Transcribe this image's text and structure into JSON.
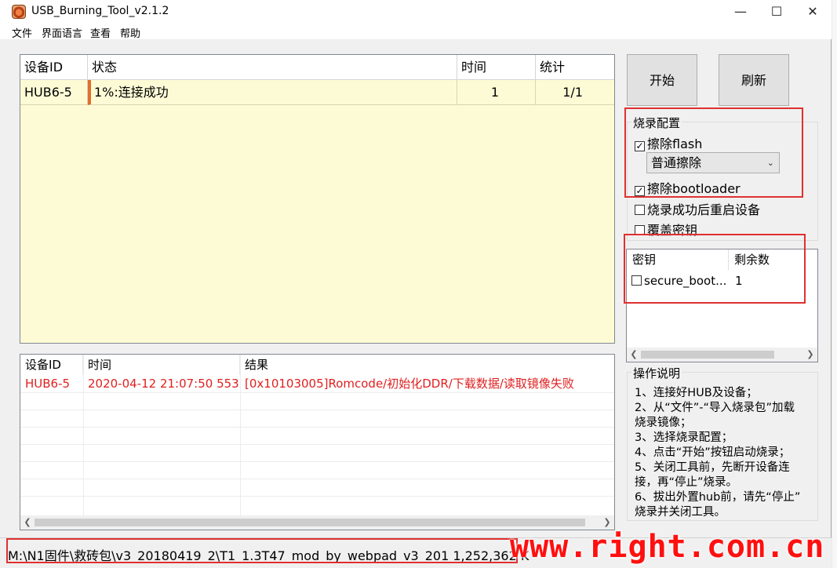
{
  "window": {
    "title": "USB_Burning_Tool_v2.1.2",
    "minimize": "—",
    "maximize": "☐",
    "close": "✕"
  },
  "menu": [
    "文件",
    "界面语言",
    "查看",
    "帮助"
  ],
  "device_table": {
    "headers": [
      "设备ID",
      "状态",
      "时间",
      "统计"
    ],
    "rows": [
      {
        "id": "HUB6-5",
        "status": "1%:连接成功",
        "time": "1",
        "count": "1/1",
        "progress": 0.01
      }
    ]
  },
  "log_table": {
    "headers": [
      "设备ID",
      "时间",
      "结果"
    ],
    "rows": [
      {
        "id": "HUB6-5",
        "time": "2020-04-12 21:07:50 553",
        "result": "[0x10103005]Romcode/初始化DDR/下载数据/读取镜像失败"
      }
    ]
  },
  "buttons": {
    "start": "开始",
    "refresh": "刷新"
  },
  "burn_config": {
    "label": "烧录配置",
    "erase_flash": {
      "label": "擦除flash",
      "checked": true
    },
    "erase_mode": "普通擦除",
    "erase_bootloader": {
      "label": "擦除bootloader",
      "checked": true
    },
    "reboot_after": {
      "label": "烧录成功后重启设备",
      "checked": false
    },
    "overwrite_key": {
      "label": "覆盖密钥",
      "checked": false
    }
  },
  "key_table": {
    "headers": [
      "密钥",
      "剩余数"
    ],
    "rows": [
      {
        "name": "secure_boot...",
        "remaining": "1",
        "checked": false
      }
    ]
  },
  "instructions": {
    "label": "操作说明",
    "lines": [
      "1、连接好HUB及设备；",
      "2、从“文件”-“导入烧录包”加载",
      "烧录镜像；",
      "3、选择烧录配置；",
      "4、点击“开始”按钮启动烧录；",
      "5、关闭工具前，先断开设备连",
      "接，再“停止”烧录。",
      "6、拔出外置hub前，请先“停止”",
      "烧录并关闭工具。"
    ]
  },
  "status_bar": {
    "path": "M:\\N1固件\\救砖包\\v3_20180419_2\\T1_1.3T47_mod_by_webpad_v3_201 1,252,362 K"
  },
  "watermark": "www.right.com.cn",
  "colors": {
    "accent_red": "#e03030",
    "row_bg": "#fdfbd6",
    "error_text": "#e02020"
  }
}
